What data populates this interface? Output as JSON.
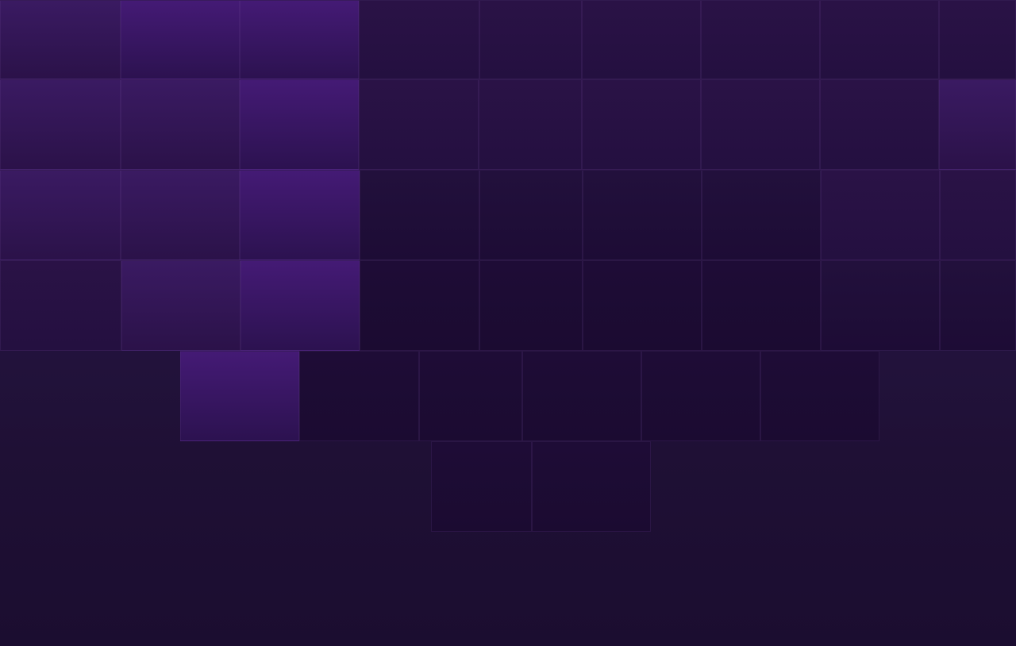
{
  "palette": {
    "background_top": "#2c1648",
    "background_bottom": "#1b0d30",
    "tile_bright_top": "#441a75",
    "tile_bright_bottom": "#2c1250",
    "tile_dark": "#1d0c35",
    "tile_border": "#6e4696"
  }
}
